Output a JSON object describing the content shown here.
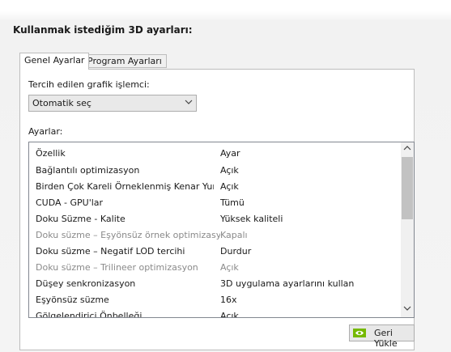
{
  "heading": "Kullanmak istediğim 3D ayarları:",
  "tabs": [
    {
      "label": "Genel Ayarlar",
      "active": true
    },
    {
      "label": "Program Ayarları",
      "active": false
    }
  ],
  "processor": {
    "label": "Tercih edilen grafik işlemci:",
    "selected": "Otomatik seç",
    "icon": "chevron-down-icon"
  },
  "settings": {
    "label": "Ayarlar:",
    "columns": [
      "Özellik",
      "Ayar"
    ],
    "rows": [
      {
        "feature": "Bağlantılı optimizasyon",
        "value": "Açık",
        "disabled": false
      },
      {
        "feature": "Birden Çok Kareli Örneklenmiş Kenar Yumu...",
        "value": "Açık",
        "disabled": false
      },
      {
        "feature": "CUDA - GPU'lar",
        "value": "Tümü",
        "disabled": false
      },
      {
        "feature": "Doku Süzme - Kalite",
        "value": "Yüksek kaliteli",
        "disabled": false
      },
      {
        "feature": "Doku süzme – Eşyönsüz örnek optimizasyonu",
        "value": "Kapalı",
        "disabled": true
      },
      {
        "feature": "Doku süzme – Negatif LOD tercihi",
        "value": "Durdur",
        "disabled": false
      },
      {
        "feature": "Doku süzme – Trilineer optimizasyon",
        "value": "Açık",
        "disabled": true
      },
      {
        "feature": "Düşey senkronizasyon",
        "value": "3D uygulama ayarlarını kullan",
        "disabled": false
      },
      {
        "feature": "Eşyönsüz süzme",
        "value": "16x",
        "disabled": false
      },
      {
        "feature": "Gölgelendirici Önbelleği",
        "value": "Açık",
        "disabled": false
      }
    ]
  },
  "reset_button": {
    "label": "Geri Yükle",
    "icon": "nvidia-logo-icon"
  },
  "colors": {
    "nvidia_green": "#76b900",
    "disabled_text": "#8a8a8a"
  }
}
